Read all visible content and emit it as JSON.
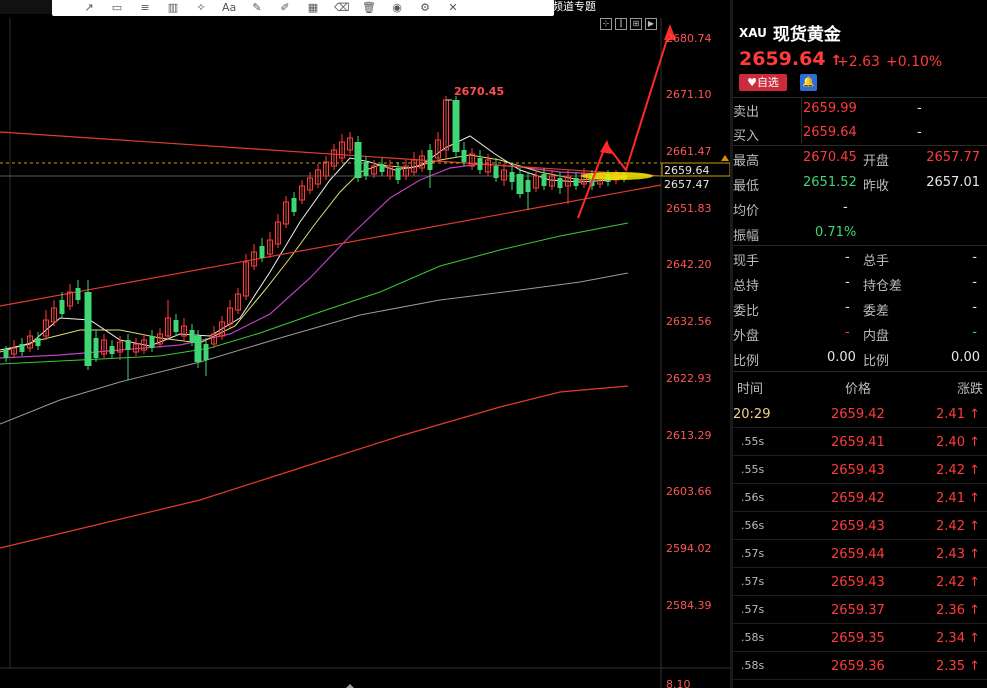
{
  "toolbar": {
    "topic_label": "频道专题",
    "icons": [
      "cursor-icon",
      "line-icon",
      "rectangle-icon",
      "horizontal-line-icon",
      "bars-icon",
      "shapes-icon",
      "text-icon",
      "pencil-icon",
      "brush-icon",
      "layout-icon",
      "eraser-icon",
      "trash-icon",
      "eye-icon",
      "settings-icon",
      "close-icon"
    ]
  },
  "chart": {
    "price_labels": [
      "2680.74",
      "2671.10",
      "2661.47",
      "2651.83",
      "2642.20",
      "2632.56",
      "2622.93",
      "2613.29",
      "2603.66",
      "2594.02",
      "2584.39",
      "8.10"
    ],
    "high_marker": "2670.45",
    "current_price_tag": "2659.64",
    "low_price_tag": "2657.47"
  },
  "quote": {
    "code": "XAU",
    "name": "现货黄金",
    "price": "2659.64",
    "change": "+2.63",
    "change_pct": "+0.10%",
    "fav_label": "自选",
    "colors": {
      "up": "#ff3b3b",
      "down": "#3fd673"
    }
  },
  "book": {
    "sell_label": "卖出",
    "sell_price": "2659.99",
    "sell_vol": "-",
    "buy_label": "买入",
    "buy_price": "2659.64",
    "buy_vol": "-"
  },
  "stats": {
    "high_label": "最高",
    "high": "2670.45",
    "open_label": "开盘",
    "open": "2657.77",
    "low_label": "最低",
    "low": "2651.52",
    "prev_label": "昨收",
    "prev": "2657.01",
    "avg_label": "均价",
    "avg": "-",
    "amp_label": "振幅",
    "amp": "0.71%",
    "now_label": "现手",
    "now": "-",
    "total_label": "总手",
    "total": "-",
    "hold_label": "总持",
    "hold": "-",
    "holddiff_label": "持仓差",
    "holddiff": "-",
    "wb_label": "委比",
    "wb": "-",
    "wc_label": "委差",
    "wc": "-",
    "outer_label": "外盘",
    "outer": "-",
    "inner_label": "内盘",
    "inner": "-",
    "ratio_label": "比例",
    "ratio": "0.00",
    "ratio2_label": "比例",
    "ratio2": "0.00"
  },
  "ticks": {
    "header_time": "时间",
    "header_price": "价格",
    "header_change": "涨跌",
    "rows": [
      {
        "time": "20:29",
        "price": "2659.42",
        "chg": "2.41"
      },
      {
        "time": ".55s",
        "price": "2659.41",
        "chg": "2.40"
      },
      {
        "time": ".55s",
        "price": "2659.43",
        "chg": "2.42"
      },
      {
        "time": ".56s",
        "price": "2659.42",
        "chg": "2.41"
      },
      {
        "time": ".56s",
        "price": "2659.43",
        "chg": "2.42"
      },
      {
        "time": ".57s",
        "price": "2659.44",
        "chg": "2.43"
      },
      {
        "time": ".57s",
        "price": "2659.43",
        "chg": "2.42"
      },
      {
        "time": ".57s",
        "price": "2659.37",
        "chg": "2.36"
      },
      {
        "time": ".58s",
        "price": "2659.35",
        "chg": "2.34"
      },
      {
        "time": ".58s",
        "price": "2659.36",
        "chg": "2.35"
      }
    ]
  }
}
